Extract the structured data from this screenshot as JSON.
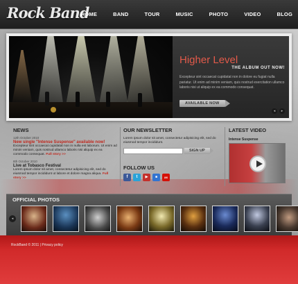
{
  "site": {
    "logo": "Rock Band"
  },
  "nav": {
    "items": [
      "HOME",
      "BAND",
      "TOUR",
      "MUSIC",
      "PHOTO",
      "VIDEO",
      "BLOG"
    ]
  },
  "slider": {
    "title": "Higher Level",
    "subtitle": "THE ALBUM OUT NOW!",
    "body": "Excepteur sint occaecat cupidatat non in dolore eu fugiat nulla pariatur. Ut enim ad minim veniam, quis nostrud exercitation ullamco laboris nisi ut aliquip ex ea commodo consequat.",
    "button": "AVAILABLE NOW",
    "prev": "◂",
    "next": "▸"
  },
  "news": {
    "heading": "NEWS",
    "items": [
      {
        "date": "12th October 2010",
        "title": "New single \"Intense Suspense\" available now!",
        "body": "Excepteur sint occaecat cupidatat non in nulla est laborum. Ut enim ad minim veniam, quis nostrud ullamco laboris nisi aliquip ex ea commodo consequat.",
        "more": "Full story >>"
      },
      {
        "date": "8th October 2010",
        "title": "Live at Tobasco Festival",
        "body": "Lorem ipsum dolor sit amet, consectetur adipisicing elit, sed do eiusmod tempor incididunt ut labore et dolore magna aliqua.",
        "more": "Full story >>"
      }
    ]
  },
  "newsletter": {
    "heading": "OUR NEWSLETTER",
    "text": "Lorem ipsum dolor sit amet, consectetur adipisicing elit, sed do eiusmod tempor incididunt.",
    "input_value": "",
    "button": "SIGN UP"
  },
  "follow": {
    "heading": "FOLLOW US",
    "icons": [
      {
        "name": "facebook-icon",
        "glyph": "f",
        "color": "#3b5998"
      },
      {
        "name": "twitter-icon",
        "glyph": "t",
        "color": "#2aa3d8"
      },
      {
        "name": "youtube-icon",
        "glyph": "▶",
        "color": "#c4302b"
      },
      {
        "name": "delicious-icon",
        "glyph": "■",
        "color": "#3274d1"
      },
      {
        "name": "lastfm-icon",
        "glyph": "as",
        "color": "#d51007"
      }
    ]
  },
  "video": {
    "heading": "LATEST VIDEO",
    "title": "Intense Suspense"
  },
  "photos": {
    "heading": "OFFICIAL PHOTOS",
    "prev": "◂",
    "next": "▸",
    "count": 9
  },
  "footer": {
    "copyright": "RockBand © 2011 | Privacy policy"
  }
}
